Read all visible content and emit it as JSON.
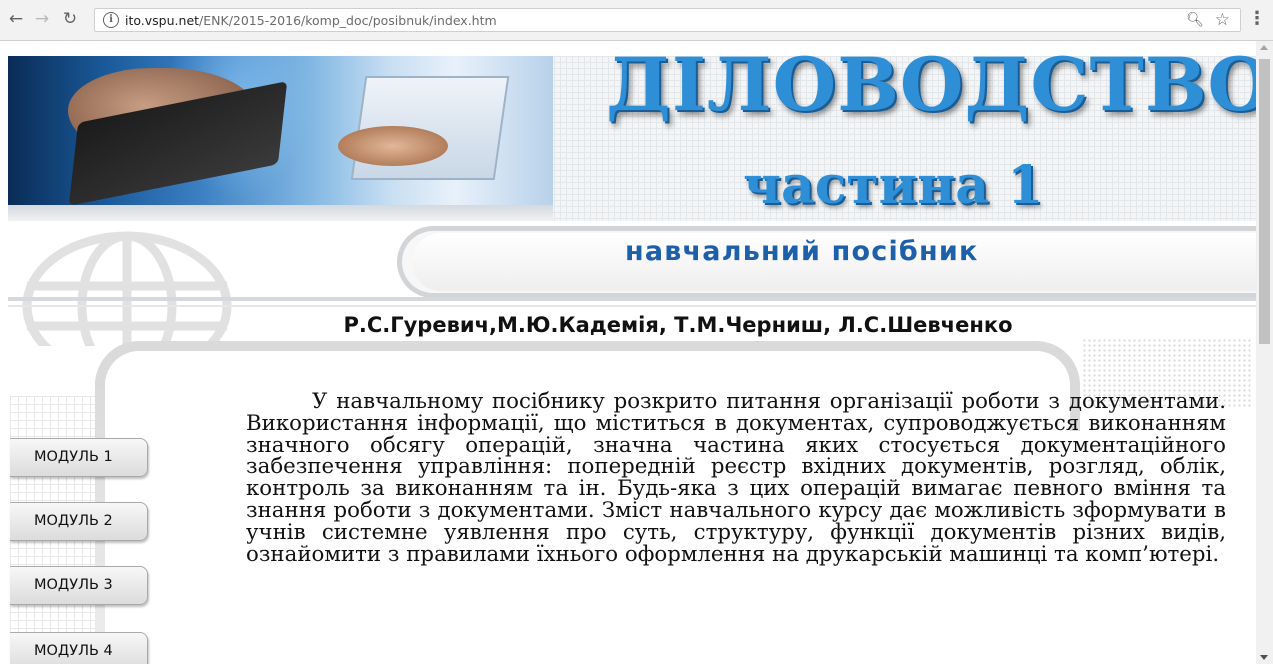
{
  "browser": {
    "url_host": "ito.vspu.net",
    "url_path": "/ENK/2015-2016/komp_doc/posibnuk/index.htm",
    "icons": [
      "back-arrow-icon",
      "forward-arrow-icon",
      "reload-icon",
      "info-icon",
      "zoom-icon",
      "star-icon",
      "menu-dots-icon"
    ]
  },
  "header": {
    "title": "ДІЛОВОДСТВО",
    "part": "частина 1",
    "subtitle": "навчальний посібник"
  },
  "authors": "Р.С.Гуревич,М.Ю.Кадемія, Т.М.Черниш, Л.С.Шевченко",
  "sidebar": {
    "modules": [
      {
        "label": "МОДУЛЬ 1"
      },
      {
        "label": "МОДУЛЬ 2"
      },
      {
        "label": "МОДУЛЬ 3"
      },
      {
        "label": "МОДУЛЬ 4"
      }
    ]
  },
  "content": {
    "intro": "У навчальному посібнику розкрито питання організації роботи з документами. Використання інформації, що міститься в документах, супроводжується виконанням значного обсягу операцій, значна частина яких стосується документаційного забезпечення управління: попередній реєстр вхідних документів, розгляд, облік, контроль за виконанням та ін. Будь-яка з цих операцій вимагає певного вміння та знання роботи з документами. Зміст навчального курсу дає можливість зформувати в учнів системне уявлення про суть, структуру, функції документів різних видів, ознайомити з правилами їхнього оформлення на друкарській машинці та комп’ютері."
  },
  "colors": {
    "title_blue": "#2f8fd6",
    "subtitle_blue": "#1d5fa8",
    "frame_gray": "#dadada"
  }
}
